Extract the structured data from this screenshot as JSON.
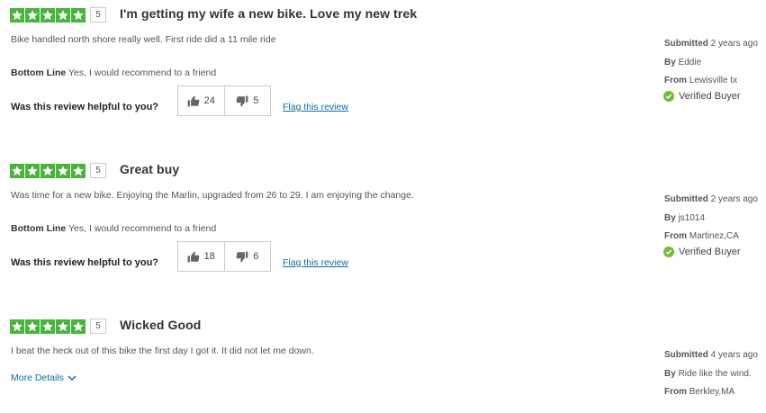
{
  "reviews": [
    {
      "rating": "5",
      "title": "I'm getting my wife a new bike. Love my new trek",
      "body": "Bike handled north shore really well. First ride did a 11 mile ride",
      "bottom_line_label": "Bottom Line",
      "bottom_line_value": "Yes, I would recommend to a friend",
      "helpful_question": "Was this review helpful to you?",
      "up_votes": "24",
      "down_votes": "5",
      "flag_label": "Flag this review",
      "submitted_label": "Submitted",
      "submitted_value": "2 years ago",
      "by_label": "By",
      "by_value": "Eddie",
      "from_label": "From",
      "from_value": "Lewisville tx",
      "verified_label": "Verified Buyer"
    },
    {
      "rating": "5",
      "title": "Great buy",
      "body": "Was time for a new bike. Enjoying the Marlin, upgraded from 26 to 29. I am enjoying the change.",
      "bottom_line_label": "Bottom Line",
      "bottom_line_value": "Yes, I would recommend to a friend",
      "helpful_question": "Was this review helpful to you?",
      "up_votes": "18",
      "down_votes": "6",
      "flag_label": "Flag this review",
      "submitted_label": "Submitted",
      "submitted_value": "2 years ago",
      "by_label": "By",
      "by_value": "js1014",
      "from_label": "From",
      "from_value": "Martinez,CA",
      "verified_label": "Verified Buyer"
    },
    {
      "rating": "5",
      "title": "Wicked Good",
      "body": "I beat the heck out of this bike the first day I got it. It did not let me down.",
      "more_details_label": "More Details",
      "submitted_label": "Submitted",
      "submitted_value": "4 years ago",
      "by_label": "By",
      "by_value": "Ride like the wind.",
      "from_label": "From",
      "from_value": "Berkley,MA"
    }
  ],
  "colors": {
    "star_green": "#47b538",
    "link_blue": "#0b6ea8",
    "check_green": "#6fbd3f"
  },
  "icons": [
    "star-icon",
    "thumbs-up-icon",
    "thumbs-down-icon",
    "check-circle-icon",
    "chevron-down-icon"
  ]
}
